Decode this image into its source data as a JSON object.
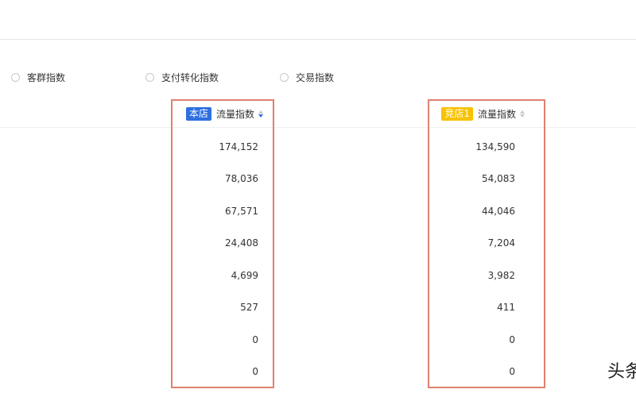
{
  "filters": {
    "options": [
      {
        "label": "客群指数"
      },
      {
        "label": "支付转化指数"
      },
      {
        "label": "交易指数"
      }
    ]
  },
  "columns": [
    {
      "badge": "本店",
      "badge_color": "#2f6fe0",
      "title": "流量指数",
      "sort": "descending",
      "values": [
        "174,152",
        "78,036",
        "67,571",
        "24,408",
        "4,699",
        "527",
        "0",
        "0"
      ]
    },
    {
      "badge": "竞店1",
      "badge_color": "#f7c200",
      "title": "流量指数",
      "sort": "none",
      "values": [
        "134,590",
        "54,083",
        "44,046",
        "7,204",
        "3,982",
        "411",
        "0",
        "0"
      ]
    }
  ],
  "highlight_color": "#e08070",
  "watermark": "头条"
}
